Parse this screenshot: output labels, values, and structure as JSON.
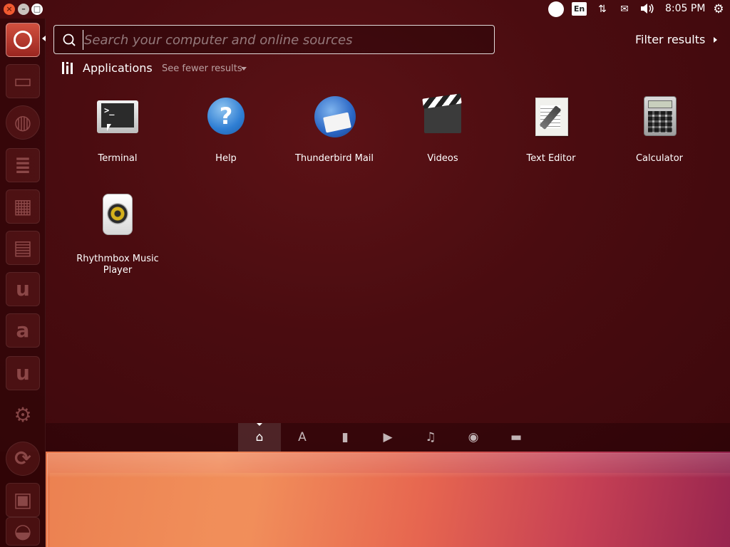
{
  "window_controls": {
    "close": "×",
    "minimize": "–",
    "maximize": "□"
  },
  "top_panel": {
    "keyboard_layout": "En",
    "clock": "8:05 PM",
    "network_glyph": "⇅",
    "mail_glyph": "✉",
    "sound_glyph": "🔊",
    "power_glyph": "⚙"
  },
  "launcher": {
    "items": [
      {
        "name": "dash-home",
        "icon": "ubuntu-logo-icon"
      },
      {
        "name": "files",
        "icon": "file-manager-icon"
      },
      {
        "name": "firefox",
        "icon": "firefox-icon"
      },
      {
        "name": "writer",
        "icon": "libreoffice-writer-icon"
      },
      {
        "name": "calc",
        "icon": "libreoffice-calc-icon"
      },
      {
        "name": "impress",
        "icon": "libreoffice-impress-icon"
      },
      {
        "name": "ubuntu-one",
        "icon": "ubuntu-one-icon",
        "glyph": "u"
      },
      {
        "name": "amazon",
        "icon": "amazon-icon",
        "glyph": "a"
      },
      {
        "name": "ubuntu-one-music",
        "icon": "ubuntu-one-music-icon",
        "glyph": "u"
      },
      {
        "name": "system-settings",
        "icon": "settings-gear-icon"
      },
      {
        "name": "software-updater",
        "icon": "software-updater-icon"
      },
      {
        "name": "workspace-switcher",
        "icon": "workspace-switcher-icon"
      },
      {
        "name": "trash",
        "icon": "trash-icon"
      }
    ]
  },
  "search": {
    "placeholder": "Search your computer and online sources",
    "value": ""
  },
  "filter_results": "Filter results",
  "category": {
    "title": "Applications",
    "see_fewer": "See fewer results"
  },
  "apps": [
    {
      "label": "Terminal",
      "icon": "terminal-icon",
      "glyph": ">_"
    },
    {
      "label": "Help",
      "icon": "help-icon",
      "glyph": "?"
    },
    {
      "label": "Thunderbird Mail",
      "icon": "thunderbird-mail-icon"
    },
    {
      "label": "Videos",
      "icon": "videos-clapperboard-icon"
    },
    {
      "label": "Text Editor",
      "icon": "text-editor-icon"
    },
    {
      "label": "Calculator",
      "icon": "calculator-icon"
    },
    {
      "label": "Rhythmbox Music Player",
      "icon": "rhythmbox-speaker-icon"
    }
  ],
  "lenses": [
    {
      "name": "home",
      "icon": "home-lens-icon",
      "glyph": "⌂",
      "active": true
    },
    {
      "name": "applications",
      "icon": "applications-lens-icon",
      "glyph": "A"
    },
    {
      "name": "files",
      "icon": "files-lens-icon",
      "glyph": "▮"
    },
    {
      "name": "video",
      "icon": "video-lens-icon",
      "glyph": "▶"
    },
    {
      "name": "music",
      "icon": "music-lens-icon",
      "glyph": "♫"
    },
    {
      "name": "photos",
      "icon": "photos-lens-icon",
      "glyph": "◉"
    },
    {
      "name": "social",
      "icon": "social-lens-icon",
      "glyph": "▬"
    }
  ],
  "colors": {
    "dash_background": "#4a0c10",
    "accent_orange": "#f15a31",
    "text": "#ffffff"
  }
}
